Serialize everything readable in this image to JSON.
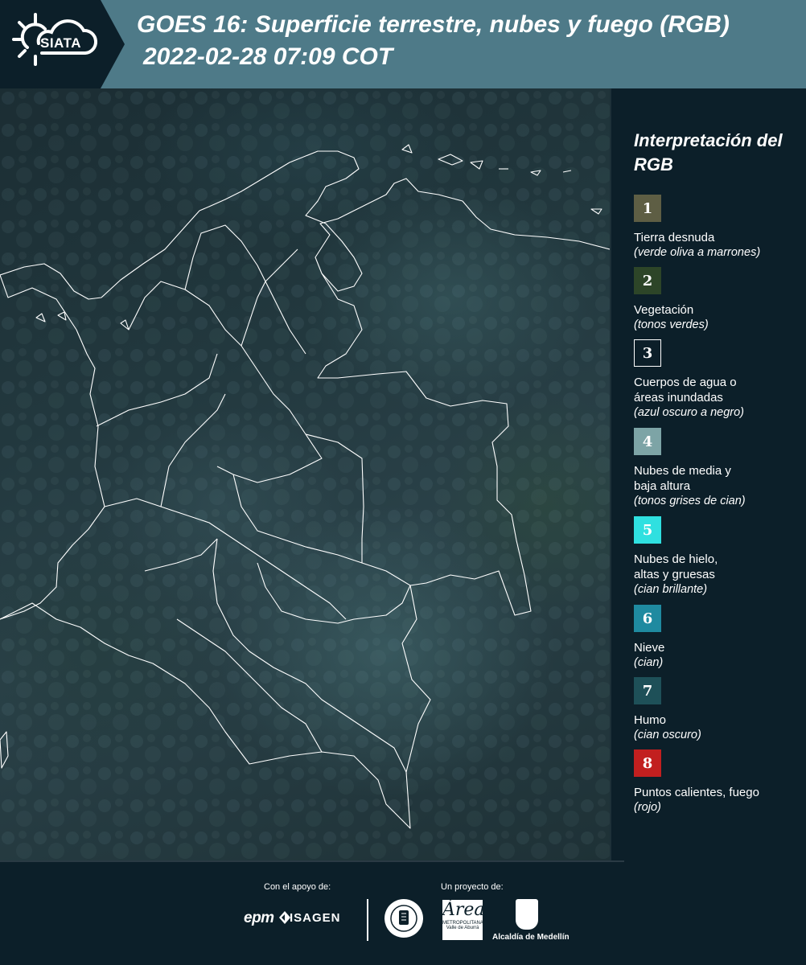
{
  "header": {
    "logo_text": "SIATA",
    "title_line1": "GOES 16: Superficie terrestre, nubes y fuego (RGB)",
    "title_line2": "2022-02-28 07:09 COT"
  },
  "legend": {
    "title": "Interpretación del RGB",
    "items": [
      {
        "number": "1",
        "label": "Tierra desnuda",
        "sub": "(verde oliva a marrones)",
        "color": "#5e5e44"
      },
      {
        "number": "2",
        "label": "Vegetación",
        "sub": "(tonos verdes)",
        "color": "#2d4528"
      },
      {
        "number": "3",
        "label": "Cuerpos de agua o áreas inundadas",
        "sub": "(azul oscuro a negro)",
        "color": "#0c1f29"
      },
      {
        "number": "4",
        "label": "Nubes de media y baja altura",
        "sub": "(tonos grises de cian)",
        "color": "#7da4a6"
      },
      {
        "number": "5",
        "label": "Nubes de hielo, altas y gruesas",
        "sub": "(cian brillante)",
        "color": "#2fe0e0"
      },
      {
        "number": "6",
        "label": "Nieve",
        "sub": "(cian)",
        "color": "#1f8aa0"
      },
      {
        "number": "7",
        "label": "Humo",
        "sub": "(cian oscuro)",
        "color": "#1e5058"
      },
      {
        "number": "8",
        "label": "Puntos calientes, fuego",
        "sub": "(rojo)",
        "color": "#c21f1f"
      }
    ]
  },
  "footer": {
    "support_label": "Con el apoyo de:",
    "project_label": "Un proyecto de:",
    "epm": "epm",
    "isagen": "ISAGEN",
    "amva_script": "Área",
    "amva_sub": "METROPOLITANA",
    "amva_sub2": "Valle de Aburrá",
    "medellin": "Alcaldía de Medellín"
  }
}
